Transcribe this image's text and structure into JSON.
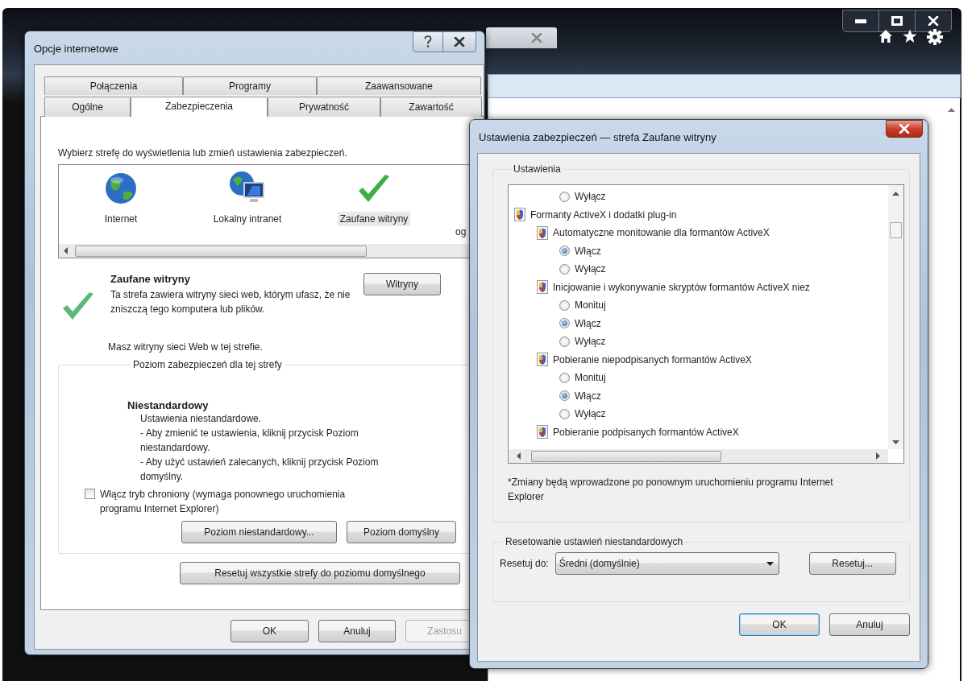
{
  "internet_options": {
    "title": "Opcje internetowe",
    "tab_rows": [
      [
        {
          "label": "Połączenia",
          "selected": false
        },
        {
          "label": "Programy",
          "selected": false
        },
        {
          "label": "Zaawansowane",
          "selected": false
        }
      ],
      [
        {
          "label": "Ogólne",
          "selected": false
        },
        {
          "label": "Zabezpieczenia",
          "selected": true
        },
        {
          "label": "Prywatność",
          "selected": false
        },
        {
          "label": "Zawartość",
          "selected": false
        }
      ]
    ],
    "prompt": "Wybierz strefę do wyświetlenia lub zmień ustawienia zabezpieczeń.",
    "zones": [
      {
        "kind": "internet",
        "label": "Internet",
        "selected": false
      },
      {
        "kind": "intranet",
        "label": "Lokalny intranet",
        "selected": false
      },
      {
        "kind": "trusted",
        "label": "Zaufane witryny",
        "selected": true
      }
    ],
    "zone_partial": "og",
    "zone_detail": {
      "title": "Zaufane witryny",
      "description": "Ta strefa zawiera witryny sieci web, którym ufasz, że nie zniszczą tego komputera lub plików.",
      "sites_button": "Witryny",
      "note": "Masz witryny sieci Web w tej strefie."
    },
    "level_group": {
      "legend": "Poziom zabezpieczeń dla tej strefy",
      "level_name": "Niestandardowy",
      "lines": [
        "Ustawienia niestandardowe.",
        "- Aby zmienić te ustawienia, kliknij przycisk Poziom niestandardowy.",
        "- Aby użyć ustawień zalecanych, kliknij przycisk Poziom domyślny."
      ],
      "protected_mode": {
        "label": "Włącz tryb chroniony (wymaga ponownego uruchomienia programu Internet Explorer)",
        "checked": false
      },
      "buttons": [
        "Poziom niestandardowy...",
        "Poziom domyślny"
      ]
    },
    "reset_all_button": "Resetuj wszystkie strefy do poziomu domyślnego",
    "footer_buttons": [
      {
        "label": "OK",
        "disabled": false
      },
      {
        "label": "Anuluj",
        "disabled": false
      },
      {
        "label": "Zastosu",
        "disabled": true
      }
    ]
  },
  "security_settings": {
    "title": "Ustawienia zabezpieczeń — strefa Zaufane witryny",
    "settings_legend": "Ustawienia",
    "tree": [
      {
        "kind": "option",
        "label": "Wyłącz",
        "selected": false
      },
      {
        "kind": "category",
        "label": "Formanty ActiveX i dodatki plug-in",
        "children": [
          {
            "kind": "setting",
            "label": "Automatyczne monitowanie dla formantów ActiveX",
            "children": [
              {
                "kind": "option",
                "label": "Włącz",
                "selected": true
              },
              {
                "kind": "option",
                "label": "Wyłącz",
                "selected": false
              }
            ]
          },
          {
            "kind": "setting",
            "label": "Inicjowanie i wykonywanie skryptów formantów ActiveX niez",
            "children": [
              {
                "kind": "option",
                "label": "Monituj",
                "selected": false
              },
              {
                "kind": "option",
                "label": "Włącz",
                "selected": true
              },
              {
                "kind": "option",
                "label": "Wyłącz",
                "selected": false
              }
            ]
          },
          {
            "kind": "setting",
            "label": "Pobieranie niepodpisanych formantów ActiveX",
            "children": [
              {
                "kind": "option",
                "label": "Monituj",
                "selected": false
              },
              {
                "kind": "option",
                "label": "Włącz",
                "selected": true
              },
              {
                "kind": "option",
                "label": "Wyłącz",
                "selected": false
              }
            ]
          },
          {
            "kind": "setting",
            "label": "Pobieranie podpisanych formantów ActiveX"
          }
        ]
      }
    ],
    "note": "*Zmiany będą wprowadzone po ponownym uruchomieniu programu Internet Explorer",
    "reset_group": {
      "legend": "Resetowanie ustawień niestandardowych",
      "label": "Resetuj do:",
      "dropdown": "Średni (domyślnie)",
      "button": "Resetuj..."
    },
    "buttons": [
      {
        "label": "OK",
        "default": true
      },
      {
        "label": "Anuluj",
        "default": false
      }
    ]
  }
}
